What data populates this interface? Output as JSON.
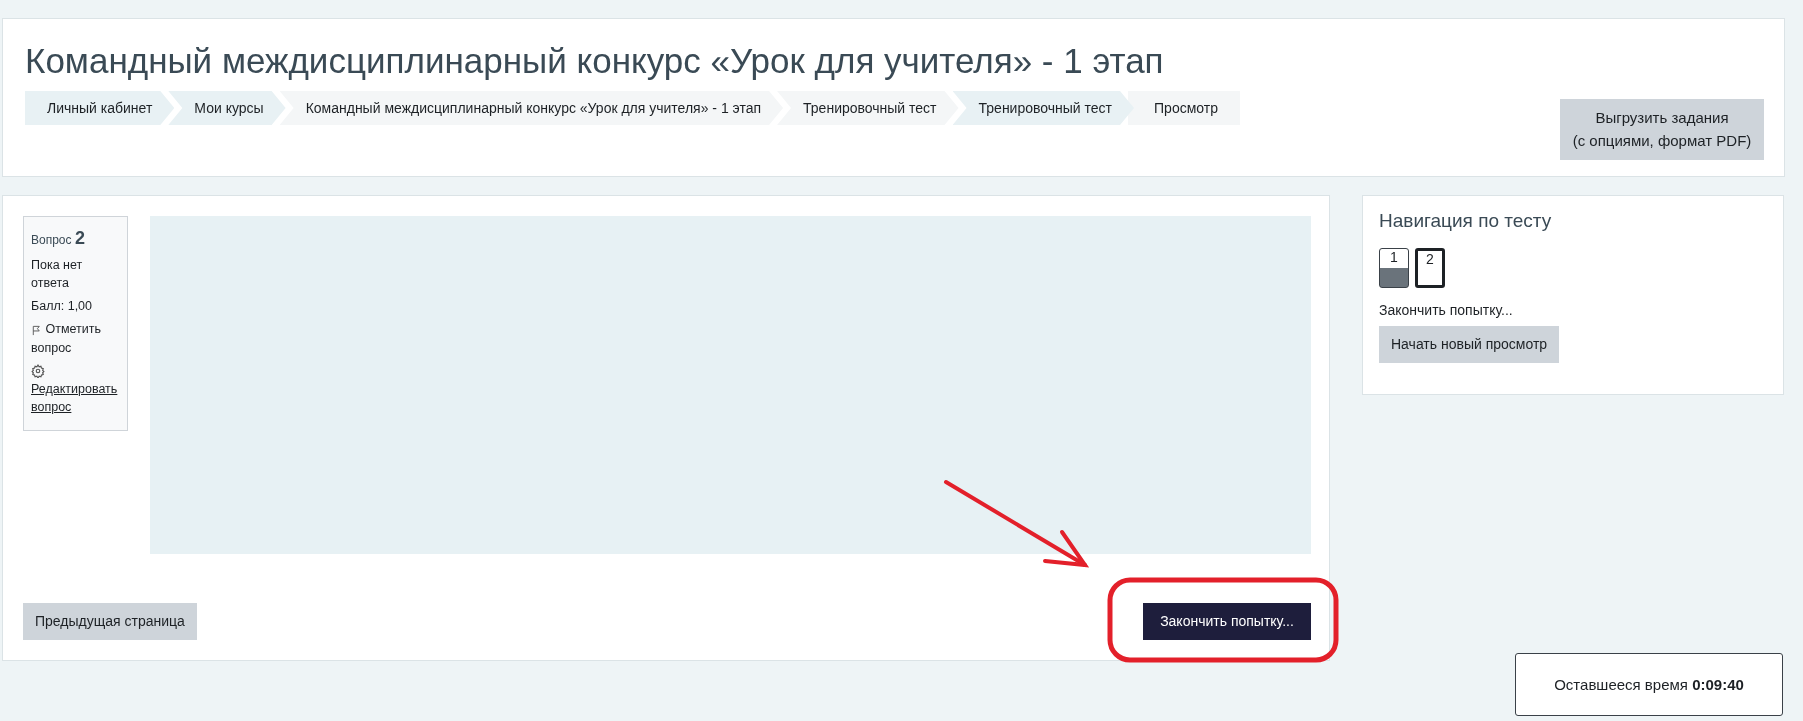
{
  "header": {
    "title": "Командный междисциплинарный конкурс «Урок для учителя» - 1 этап",
    "breadcrumb": [
      {
        "label": "Личный кабинет"
      },
      {
        "label": "Мои курсы"
      },
      {
        "label": "Командный междисциплинарный конкурс «Урок для учителя» - 1 этап"
      },
      {
        "label": "Тренировочный тест"
      },
      {
        "label": "Тренировочный тест"
      },
      {
        "label": "Просмотр"
      }
    ],
    "export_button": [
      "Выгрузить задания",
      "(с опциями, формат PDF)"
    ]
  },
  "question_info": {
    "label": "Вопрос",
    "number": "2",
    "status": "Пока нет ответа",
    "grade": "Балл: 1,00",
    "flag": "Отметить вопрос",
    "edit": "Редактировать вопрос"
  },
  "buttons": {
    "previous": "Предыдущая страница",
    "finish": "Закончить попытку..."
  },
  "navigation": {
    "title": "Навигация по тесту",
    "questions": [
      {
        "label": "1",
        "answered": true,
        "selected": false
      },
      {
        "label": "2",
        "answered": false,
        "selected": true
      }
    ],
    "finish_link": "Закончить попытку...",
    "new_preview": "Начать новый просмотр"
  },
  "timer": {
    "label": "Оставшееся время",
    "value": "0:09:40"
  }
}
